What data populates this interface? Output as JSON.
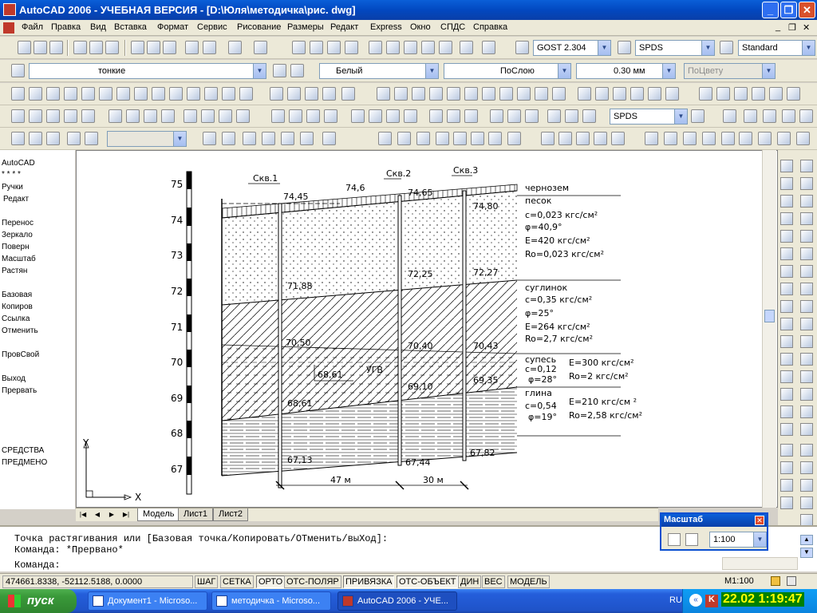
{
  "window": {
    "title": "AutoCAD 2006 - УЧЕБНАЯ ВЕРСИЯ - [D:\\Юля\\методичка\\рис. dwg]"
  },
  "menu": [
    "Файл",
    "Правка",
    "Вид",
    "Вставка",
    "Формат",
    "Сервис",
    "Рисование",
    "Размеры",
    "Редакт",
    "Express",
    "Окно",
    "СПДС",
    "Справка"
  ],
  "toolbar": {
    "textstyle": "GOST 2.304",
    "dimstyle": "SPDS",
    "tablestyle": "Standard",
    "layer": "тонкие",
    "color": "Белый",
    "linetype": "ПоСлою",
    "lineweight": "0.30 мм",
    "plotstyle": "ПоЦвету",
    "spds_combo": "SPDS"
  },
  "left_menu": [
    "AutoCAD",
    "* * * *",
    "Ручки",
    "Редакт",
    "",
    "Перенос",
    "Зеркало",
    "Поверн",
    "Масштаб",
    "Растян",
    "",
    "Базовая",
    "Копиров",
    "Ссылка",
    "Отменить",
    "",
    "ПровСвой",
    "",
    "Выход",
    "Прервать",
    "",
    "",
    "",
    "",
    "СРЕДСТВА",
    "ПРЕДМЕНО"
  ],
  "drawing": {
    "well_labels": [
      "Скв.1",
      "Скв.2",
      "Скв.3"
    ],
    "scale_ticks": [
      "75",
      "74",
      "73",
      "72",
      "71",
      "70",
      "69",
      "68",
      "67"
    ],
    "top_elevs": [
      "74,45",
      "74,6",
      "74,65",
      "74,80"
    ],
    "elev_labels": [
      "71,88",
      "72,25",
      "72,27",
      "70,50",
      "70,40",
      "70,43",
      "68,61",
      "69,10",
      "69,35",
      "68,61",
      "67,13",
      "67,44",
      "67,82"
    ],
    "ugv_label": "УГВ",
    "layers": [
      {
        "name": "чернозем",
        "props": []
      },
      {
        "name": "песок",
        "props": [
          "c=0,023 кгс/см²",
          "φ=40,9°",
          "E=420 кгс/см²",
          "Ro=0,023 кгс/см²"
        ]
      },
      {
        "name": "суглинок",
        "props": [
          "c=0,35 кгс/см²",
          "φ=25°",
          "E=264 кгс/см²",
          "Ro=2,7 кгс/см²"
        ]
      },
      {
        "name": "супесь",
        "props": [
          "c=0,12",
          "φ=28°",
          "E=300 кгс/см²",
          "Ro=2 кгс/см²"
        ]
      },
      {
        "name": "глина",
        "props": [
          "c=0,54",
          "φ=19°",
          "E=210 кгс/см ²",
          "Ro=2,58 кгс/см²"
        ]
      }
    ],
    "dims": [
      "47 м",
      "30 м"
    ],
    "axis_y": "Y",
    "axis_x": "X"
  },
  "tabs": [
    "Модель",
    "Лист1",
    "Лист2"
  ],
  "command": {
    "line1": "Точка растягивания или [Базовая точка/Копировать/ОТменить/выХод]:",
    "line2": "Команда: *Прервано*",
    "line3": "Команда:"
  },
  "status": {
    "coords": "474661.8338, -52112.5188, 0.0000",
    "buttons": [
      "ШАГ",
      "СЕТКА",
      "ОРТО",
      "ОТС-ПОЛЯР",
      "ПРИВЯЗКА",
      "ОТС-ОБЪЕКТ",
      "ДИН",
      "ВЕС",
      "МОДЕЛЬ"
    ],
    "scale": "M1:100"
  },
  "scale_panel": {
    "title": "Масштаб",
    "value": "1:100"
  },
  "taskbar": {
    "start": "пуск",
    "tasks": [
      "Документ1 - Microso...",
      "методичка - Microso...",
      "AutoCAD 2006 - УЧЕ..."
    ],
    "lang": "RU",
    "clock": "22.02 1:19:47"
  }
}
